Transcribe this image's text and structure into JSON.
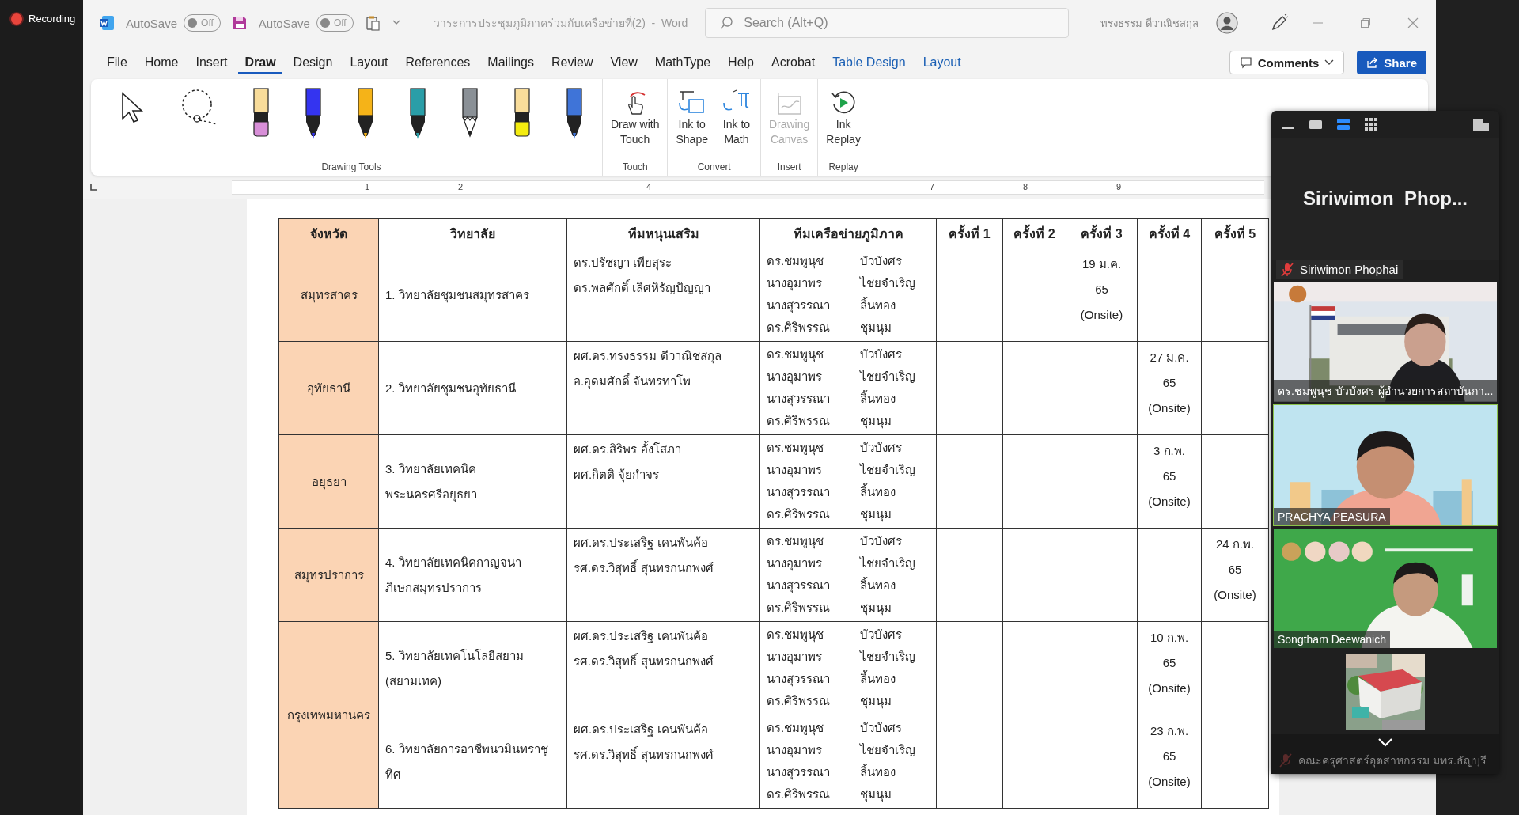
{
  "recording": {
    "label": "Recording"
  },
  "word": {
    "quick_access": [
      {
        "kind": "logo"
      },
      {
        "kind": "toggle",
        "label": "AutoSave",
        "state": "Off",
        "on": false
      },
      {
        "kind": "save"
      },
      {
        "kind": "toggle",
        "label": "AutoSave",
        "state": "Off",
        "on": false
      },
      {
        "kind": "clipboard"
      },
      {
        "kind": "caret"
      }
    ],
    "title": "วาระการประชุมภูมิภาคร่วมกับเครือข่ายที่(2)  -  Word",
    "search": {
      "placeholder": "Search (Alt+Q)"
    },
    "user": "ทรงธรรม ดีวาณิชสกุล",
    "menu": [
      {
        "label": "File",
        "selected": false,
        "contextual": false
      },
      {
        "label": "Home",
        "selected": false,
        "contextual": false
      },
      {
        "label": "Insert",
        "selected": false,
        "contextual": false
      },
      {
        "label": "Draw",
        "selected": true,
        "contextual": false
      },
      {
        "label": "Design",
        "selected": false,
        "contextual": false
      },
      {
        "label": "Layout",
        "selected": false,
        "contextual": false
      },
      {
        "label": "References",
        "selected": false,
        "contextual": false
      },
      {
        "label": "Mailings",
        "selected": false,
        "contextual": false
      },
      {
        "label": "Review",
        "selected": false,
        "contextual": false
      },
      {
        "label": "View",
        "selected": false,
        "contextual": false
      },
      {
        "label": "MathType",
        "selected": false,
        "contextual": false
      },
      {
        "label": "Help",
        "selected": false,
        "contextual": false
      },
      {
        "label": "Acrobat",
        "selected": false,
        "contextual": false
      },
      {
        "label": "Table Design",
        "selected": false,
        "contextual": true
      },
      {
        "label": "Layout",
        "selected": false,
        "contextual": true
      }
    ],
    "comments": "Comments",
    "share": "Share",
    "ribbon": [
      {
        "label": "Drawing Tools",
        "tools": [
          {
            "kind": "select"
          },
          {
            "kind": "lasso"
          },
          {
            "kind": "highlighter",
            "color": "#d88fd8"
          },
          {
            "kind": "pen",
            "color": "#3434f0"
          },
          {
            "kind": "pen",
            "color": "#f5b318"
          },
          {
            "kind": "pen",
            "color": "#2a9ea8"
          },
          {
            "kind": "pencil",
            "color": "#8a9096"
          },
          {
            "kind": "highlighter",
            "color": "#f4ec10"
          },
          {
            "kind": "pen",
            "color": "#3f74d8"
          }
        ]
      },
      {
        "label": "Touch",
        "tools": [
          {
            "kind": "touch",
            "lines": [
              "Draw with",
              "Touch"
            ],
            "disabled": false
          }
        ]
      },
      {
        "label": "Convert",
        "tools": [
          {
            "kind": "shape",
            "lines": [
              "Ink to",
              "Shape"
            ],
            "disabled": false
          },
          {
            "kind": "math",
            "lines": [
              "Ink to",
              "Math"
            ],
            "disabled": false
          }
        ]
      },
      {
        "label": "Insert",
        "tools": [
          {
            "kind": "canvas",
            "lines": [
              "Drawing",
              "Canvas"
            ],
            "disabled": true
          }
        ]
      },
      {
        "label": "Replay",
        "tools": [
          {
            "kind": "replay",
            "lines": [
              "Ink",
              "Replay"
            ],
            "disabled": false
          }
        ]
      }
    ],
    "ruler": [
      "1",
      "2",
      "4",
      "7",
      "8",
      "9"
    ],
    "table": {
      "columns": [
        "จังหวัด",
        "วิทยาลัย",
        "ทีมหนุนเสริม",
        "ทีมเครือข่ายภูมิภาค",
        "ครั้งที่ 1",
        "ครั้งที่ 2",
        "ครั้งที่ 3",
        "ครั้งที่ 4",
        "ครั้งที่ 5"
      ],
      "provinces": [
        {
          "name": "สมุทรสาคร",
          "colleges": [
            {
              "name": [
                "1. วิทยาลัยชุมชนสมุทรสาคร"
              ],
              "mentors": [
                "ดร.ปรัชญา  เพียสุระ",
                "ดร.พลศักดิ์  เลิศหิรัญปัญญา"
              ],
              "network": [
                [
                  "ดร.ชมพูนุช",
                  "บัวบังศร"
                ],
                [
                  "นางอุมาพร",
                  "ไชยจำเริญ"
                ],
                [
                  "นางสุวรรณา",
                  "ลิ้นทอง"
                ],
                [
                  "ดร.ศิริพรรณ",
                  "ชุมนุม"
                ]
              ],
              "sessions": {
                "round_3": [
                  "19 ม.ค.",
                  "65",
                  "(Onsite)"
                ]
              }
            }
          ]
        },
        {
          "name": "อุทัยธานี",
          "colleges": [
            {
              "name": [
                "2. วิทยาลัยชุมชนอุทัยธานี"
              ],
              "mentors": [
                "ผศ.ดร.ทรงธรรม  ดีวาณิชสกุล",
                "อ.อุดมศักดิ์  จันทรทาโพ"
              ],
              "network": [
                [
                  "ดร.ชมพูนุช",
                  "บัวบังศร"
                ],
                [
                  "นางอุมาพร",
                  "ไชยจำเริญ"
                ],
                [
                  "นางสุวรรณา",
                  "ลิ้นทอง"
                ],
                [
                  "ดร.ศิริพรรณ",
                  "ชุมนุม"
                ]
              ],
              "sessions": {
                "round_4": [
                  "27 ม.ค.",
                  "65",
                  "(Onsite)"
                ]
              }
            }
          ]
        },
        {
          "name": "อยุธยา",
          "colleges": [
            {
              "name": [
                "3. วิทยาลัยเทคนิค",
                "พระนครศรีอยุธยา"
              ],
              "mentors": [
                "ผศ.ดร.สิริพร  อั้งโสภา",
                "ผศ.กิตติ  จุ้ยกำจร"
              ],
              "network": [
                [
                  "ดร.ชมพูนุช",
                  "บัวบังศร"
                ],
                [
                  "นางอุมาพร",
                  "ไชยจำเริญ"
                ],
                [
                  "นางสุวรรณา",
                  "ลิ้นทอง"
                ],
                [
                  "ดร.ศิริพรรณ",
                  "ชุมนุม"
                ]
              ],
              "sessions": {
                "round_4": [
                  "3 ก.พ.",
                  "65",
                  "(Onsite)"
                ]
              }
            }
          ]
        },
        {
          "name": "สมุทรปราการ",
          "colleges": [
            {
              "name": [
                "4. วิทยาลัยเทคนิคกาญจนา",
                "ภิเษกสมุทรปราการ"
              ],
              "mentors": [
                "ผศ.ดร.ประเสริฐ  เคนพันค้อ",
                "รศ.ดร.วิสุทธิ์  สุนทรกนกพงศ์"
              ],
              "network": [
                [
                  "ดร.ชมพูนุช",
                  "บัวบังศร"
                ],
                [
                  "นางอุมาพร",
                  "ไชยจำเริญ"
                ],
                [
                  "นางสุวรรณา",
                  "ลิ้นทอง"
                ],
                [
                  "ดร.ศิริพรรณ",
                  "ชุมนุม"
                ]
              ],
              "sessions": {
                "round_5": [
                  "24 ก.พ.",
                  "65",
                  "(Onsite)"
                ]
              }
            }
          ]
        },
        {
          "name": "กรุงเทพมหานคร",
          "colleges": [
            {
              "name": [
                "5. วิทยาลัยเทคโนโลยีสยาม",
                "(สยามเทค)"
              ],
              "mentors": [
                "ผศ.ดร.ประเสริฐ  เคนพันค้อ",
                "รศ.ดร.วิสุทธิ์  สุนทรกนกพงศ์"
              ],
              "network": [
                [
                  "ดร.ชมพูนุช",
                  "บัวบังศร"
                ],
                [
                  "นางอุมาพร",
                  "ไชยจำเริญ"
                ],
                [
                  "นางสุวรรณา",
                  "ลิ้นทอง"
                ],
                [
                  "ดร.ศิริพรรณ",
                  "ชุมนุม"
                ]
              ],
              "sessions": {
                "round_4": [
                  "10 ก.พ.",
                  "65",
                  "(Onsite)"
                ]
              }
            },
            {
              "name": [
                "6. วิทยาลัยการอาชีพนวมินทราชู",
                "ทิศ"
              ],
              "mentors": [
                "ผศ.ดร.ประเสริฐ เคนพันค้อ",
                "รศ.ดร.วิสุทธิ์ สุนทรกนกพงศ์"
              ],
              "network": [
                [
                  "ดร.ชมพูนุช",
                  "บัวบังศร"
                ],
                [
                  "นางอุมาพร",
                  "ไชยจำเริญ"
                ],
                [
                  "นางสุวรรณา",
                  "ลิ้นทอง"
                ],
                [
                  "ดร.ศิริพรรณ",
                  "ชุมนุม"
                ]
              ],
              "sessions": {
                "round_4": [
                  "23 ก.พ.",
                  "65",
                  "(Onsite)"
                ]
              }
            }
          ]
        }
      ]
    }
  },
  "meeting": {
    "views": [
      {
        "kind": "minimize",
        "selected": false
      },
      {
        "kind": "speaker",
        "selected": false
      },
      {
        "kind": "strip",
        "selected": true
      },
      {
        "kind": "gallery",
        "selected": false
      }
    ],
    "speaker_name": "Siriwimon  Phop...",
    "speaker_label": {
      "name": "Siriwimon Phophai",
      "muted": true
    },
    "tiles": [
      {
        "name": "ดร.ชมพูนุช บัวบังศร ผู้อำนวยการสถาบันกา...",
        "active": false
      },
      {
        "name": "PRACHYA PEASURA",
        "active": true
      },
      {
        "name": "Songtham Deewanich",
        "active": false
      }
    ],
    "last": {
      "name": "คณะครุศาสตร์อุตสาหกรรม มทร.ธัญบุรี",
      "muted": true
    }
  }
}
